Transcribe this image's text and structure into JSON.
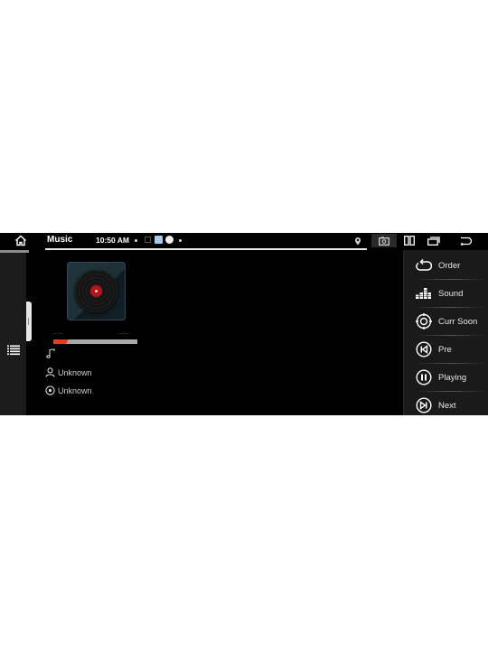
{
  "status_bar": {
    "app_title": "Music",
    "time": "10:50 AM",
    "icons": [
      "home-icon",
      "notification-dot",
      "notification-square",
      "notification-app-blue",
      "notification-circle",
      "notification-dot",
      "location-icon",
      "screenshot-icon",
      "split-screen-icon",
      "recent-apps-icon",
      "back-icon"
    ]
  },
  "drawer": {
    "menu_icon": "list-menu-icon"
  },
  "player": {
    "album_art": "vinyl-record",
    "elapsed_time": "--:--",
    "total_time": "--:--",
    "progress": 0.18,
    "track_title": "",
    "artist": "Unknown",
    "album": "Unknown"
  },
  "controls": [
    {
      "id": "order",
      "label": "Order",
      "icon": "repeat-order-icon"
    },
    {
      "id": "sound",
      "label": "Sound",
      "icon": "equalizer-icon"
    },
    {
      "id": "curr-soon",
      "label": "Curr Soon",
      "icon": "target-icon"
    },
    {
      "id": "pre",
      "label": "Pre",
      "icon": "previous-icon"
    },
    {
      "id": "playing",
      "label": "Playing",
      "icon": "pause-icon"
    },
    {
      "id": "next",
      "label": "Next",
      "icon": "next-icon"
    }
  ],
  "colors": {
    "accent": "#e1401c",
    "disc_label": "#b4141c",
    "background": "#000000",
    "panel": "#1a1a1a"
  }
}
